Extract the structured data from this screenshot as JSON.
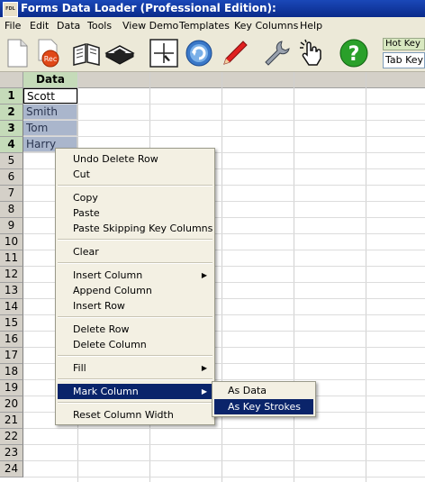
{
  "window": {
    "title": "Forms Data Loader (Professional Edition):",
    "icon_text": "FDL"
  },
  "menu": [
    "File",
    "Edit",
    "Data",
    "Tools",
    "View Demo",
    "Templates",
    "Key Columns",
    "Help"
  ],
  "toolbar": {
    "rec_label": "Rec",
    "hotkey_label": "Hot Key",
    "hotkey_value": "Tab Key"
  },
  "grid": {
    "column_header": "Data",
    "rows": [
      "1",
      "2",
      "3",
      "4",
      "5",
      "6",
      "7",
      "8",
      "9",
      "10",
      "11",
      "12",
      "13",
      "14",
      "15",
      "16",
      "17",
      "18",
      "19",
      "20",
      "21",
      "22",
      "23",
      "24"
    ],
    "cells": [
      "Scott",
      "Smith",
      "Tom",
      "Harry"
    ]
  },
  "context_menu": {
    "items": [
      "Undo Delete Row",
      "Cut",
      "Copy",
      "Paste",
      "Paste Skipping Key Columns",
      "Clear",
      "Insert Column",
      "Append Column",
      "Insert Row",
      "Delete Row",
      "Delete Column",
      "Fill",
      "Mark Column",
      "Reset Column Width"
    ]
  },
  "submenu": {
    "items": [
      "As Data",
      "As Key Strokes"
    ]
  },
  "colors": {
    "title_bar": "#0a2a8a",
    "highlight": "#0a246a",
    "selected_cells": "#aab6cc",
    "header_green": "#c5dbb9"
  }
}
